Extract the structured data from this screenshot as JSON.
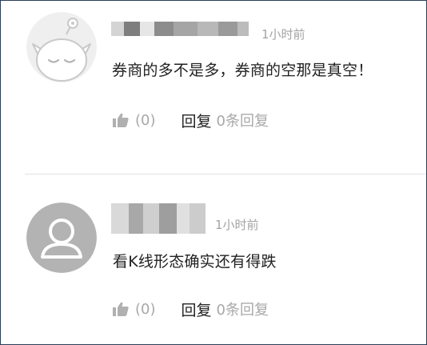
{
  "comments": [
    {
      "time": "1小时前",
      "text": "券商的多不是多，券商的空那是真空！",
      "like_count": "(0)",
      "reply_label": "回复",
      "reply_count": "0条回复",
      "avatar_icon": "robot-face-icon"
    },
    {
      "time": "1小时前",
      "text": "看K线形态确实还有得跌",
      "like_count": "(0)",
      "reply_label": "回复",
      "reply_count": "0条回复",
      "avatar_icon": "default-user-icon"
    }
  ],
  "colors": {
    "border": "#2b3f57",
    "muted_text": "#a8a8a8",
    "body_text": "#222222",
    "divider": "#e2e2e2",
    "avatar_bg": "#b3b3b3"
  }
}
